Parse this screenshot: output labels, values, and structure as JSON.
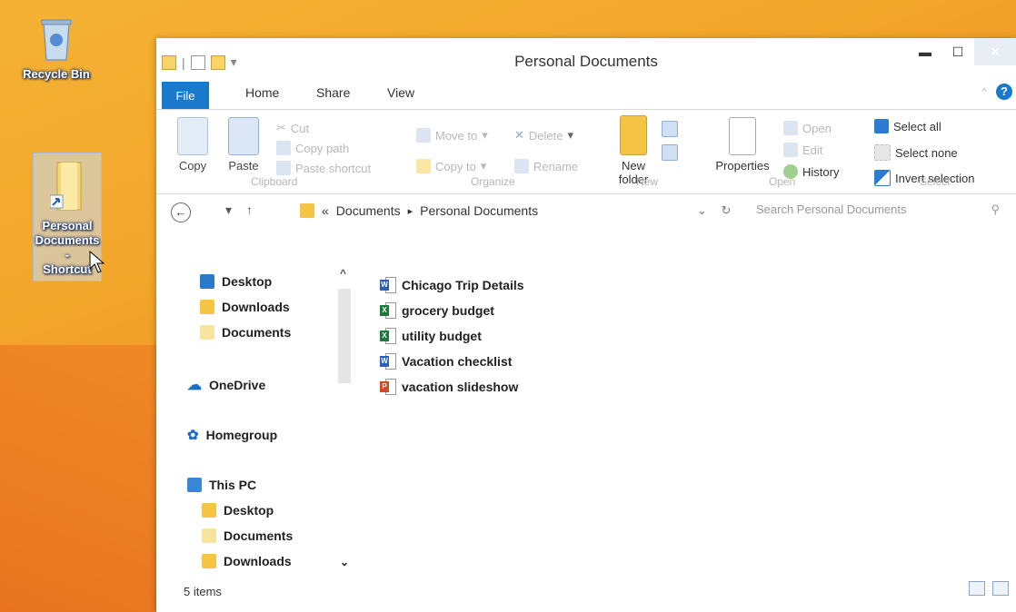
{
  "desktop": {
    "recycle_bin_label": "Recycle Bin",
    "shortcut_label_1": "Personal",
    "shortcut_label_2": "Documents -",
    "shortcut_label_3": "Shortcut"
  },
  "window": {
    "title": "Personal Documents",
    "tabs": {
      "file": "File",
      "home": "Home",
      "share": "Share",
      "view": "View"
    },
    "help": "?"
  },
  "ribbon": {
    "clipboard": {
      "copy": "Copy",
      "paste": "Paste",
      "cut": "Cut",
      "copy_path": "Copy path",
      "paste_shortcut": "Paste shortcut",
      "label": "Clipboard"
    },
    "organize": {
      "move_to": "Move to",
      "delete": "Delete",
      "copy_to": "Copy to",
      "rename": "Rename",
      "label": "Organize"
    },
    "new": {
      "new_folder_1": "New",
      "new_folder_2": "folder",
      "label": "New"
    },
    "open": {
      "properties": "Properties",
      "open": "Open",
      "edit": "Edit",
      "history": "History",
      "label": "Open"
    },
    "select": {
      "select_all": "Select all",
      "select_none": "Select none",
      "invert_selection": "Invert selection",
      "label": "Select"
    }
  },
  "address": {
    "chevrons": "«",
    "crumb_1": "Documents",
    "crumb_2": "Personal Documents",
    "search_placeholder": "Search Personal Documents"
  },
  "nav": {
    "quick": [
      "Desktop",
      "Downloads",
      "Documents"
    ],
    "onedrive": "OneDrive",
    "homegroup": "Homegroup",
    "thispc": "This PC",
    "pc_items": [
      "Desktop",
      "Documents",
      "Downloads"
    ]
  },
  "files": [
    {
      "name": "Chicago Trip Details",
      "type": "word",
      "color": "#2b5fb4"
    },
    {
      "name": "grocery budget",
      "type": "excel",
      "color": "#1e7a3c"
    },
    {
      "name": "utility budget",
      "type": "excel",
      "color": "#1e7a3c"
    },
    {
      "name": "Vacation checklist",
      "type": "word",
      "color": "#2b5fb4"
    },
    {
      "name": "vacation slideshow",
      "type": "powerpoint",
      "color": "#d04a23"
    }
  ],
  "status": {
    "count": "5 items"
  },
  "colors": {
    "accent": "#1979ca",
    "folder": "#f6c445"
  }
}
